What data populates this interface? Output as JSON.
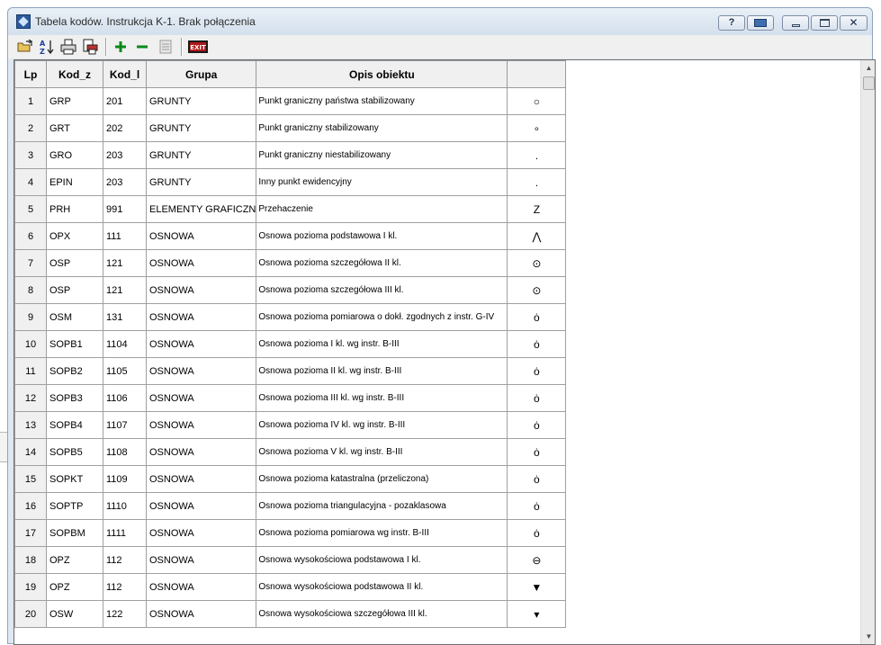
{
  "window": {
    "title": "Tabela kodów. Instrukcja K-1. Brak połączenia",
    "help_label": "?",
    "close_label": "✕"
  },
  "toolbar": {
    "exit_label": "EXIT"
  },
  "table": {
    "headers": [
      "Lp",
      "Kod_z",
      "Kod_l",
      "Grupa",
      "Opis obiektu",
      ""
    ],
    "rows": [
      {
        "lp": "1",
        "kod_z": "GRP",
        "kod_l": "201",
        "grupa": "GRUNTY",
        "opis": "Punkt graniczny państwa stabilizowany",
        "symbol": "○"
      },
      {
        "lp": "2",
        "kod_z": "GRT",
        "kod_l": "202",
        "grupa": "GRUNTY",
        "opis": "Punkt graniczny stabilizowany",
        "symbol": "∘"
      },
      {
        "lp": "3",
        "kod_z": "GRO",
        "kod_l": "203",
        "grupa": "GRUNTY",
        "opis": "Punkt graniczny niestabilizowany",
        "symbol": "."
      },
      {
        "lp": "4",
        "kod_z": "EPIN",
        "kod_l": "203",
        "grupa": "GRUNTY",
        "opis": "Inny punkt ewidencyjny",
        "symbol": "."
      },
      {
        "lp": "5",
        "kod_z": "PRH",
        "kod_l": "991",
        "grupa": "ELEMENTY GRAFICZN",
        "opis": "Przehaczenie",
        "symbol": "Z"
      },
      {
        "lp": "6",
        "kod_z": "OPX",
        "kod_l": "111",
        "grupa": "OSNOWA",
        "opis": "Osnowa pozioma podstawowa I kl.",
        "symbol": "⋀"
      },
      {
        "lp": "7",
        "kod_z": "OSP",
        "kod_l": "121",
        "grupa": "OSNOWA",
        "opis": "Osnowa pozioma szczegółowa II kl.",
        "symbol": "⊙"
      },
      {
        "lp": "8",
        "kod_z": "OSP",
        "kod_l": "121",
        "grupa": "OSNOWA",
        "opis": "Osnowa pozioma szczegółowa III kl.",
        "symbol": "⊙"
      },
      {
        "lp": "9",
        "kod_z": "OSM",
        "kod_l": "131",
        "grupa": "OSNOWA",
        "opis": "Osnowa pozioma pomiarowa o dokł. zgodnych z instr. G-IV",
        "symbol": "ȯ"
      },
      {
        "lp": "10",
        "kod_z": "SOPB1",
        "kod_l": "1104",
        "grupa": "OSNOWA",
        "opis": "Osnowa pozioma I kl. wg instr. B-III",
        "symbol": "ȯ"
      },
      {
        "lp": "11",
        "kod_z": "SOPB2",
        "kod_l": "1105",
        "grupa": "OSNOWA",
        "opis": "Osnowa pozioma II kl. wg instr. B-III",
        "symbol": "ȯ"
      },
      {
        "lp": "12",
        "kod_z": "SOPB3",
        "kod_l": "1106",
        "grupa": "OSNOWA",
        "opis": "Osnowa pozioma III kl. wg instr. B-III",
        "symbol": "ȯ"
      },
      {
        "lp": "13",
        "kod_z": "SOPB4",
        "kod_l": "1107",
        "grupa": "OSNOWA",
        "opis": "Osnowa pozioma IV kl. wg instr. B-III",
        "symbol": "ȯ"
      },
      {
        "lp": "14",
        "kod_z": "SOPB5",
        "kod_l": "1108",
        "grupa": "OSNOWA",
        "opis": "Osnowa pozioma V kl. wg instr. B-III",
        "symbol": "ȯ"
      },
      {
        "lp": "15",
        "kod_z": "SOPKT",
        "kod_l": "1109",
        "grupa": "OSNOWA",
        "opis": "Osnowa pozioma katastralna (przeliczona)",
        "symbol": "ȯ"
      },
      {
        "lp": "16",
        "kod_z": "SOPTP",
        "kod_l": "1110",
        "grupa": "OSNOWA",
        "opis": "Osnowa pozioma triangulacyjna - pozaklasowa",
        "symbol": "ȯ"
      },
      {
        "lp": "17",
        "kod_z": "SOPBM",
        "kod_l": "1111",
        "grupa": "OSNOWA",
        "opis": "Osnowa pozioma pomiarowa wg instr. B-III",
        "symbol": "ȯ"
      },
      {
        "lp": "18",
        "kod_z": "OPZ",
        "kod_l": "112",
        "grupa": "OSNOWA",
        "opis": "Osnowa wysokościowa podstawowa I kl.",
        "symbol": "⊖"
      },
      {
        "lp": "19",
        "kod_z": "OPZ",
        "kod_l": "112",
        "grupa": "OSNOWA",
        "opis": "Osnowa wysokościowa podstawowa II kl.",
        "symbol": "▼"
      },
      {
        "lp": "20",
        "kod_z": "OSW",
        "kod_l": "122",
        "grupa": "OSNOWA",
        "opis": "Osnowa wysokościowa szczegółowa III kl.",
        "symbol": "▾"
      }
    ]
  }
}
